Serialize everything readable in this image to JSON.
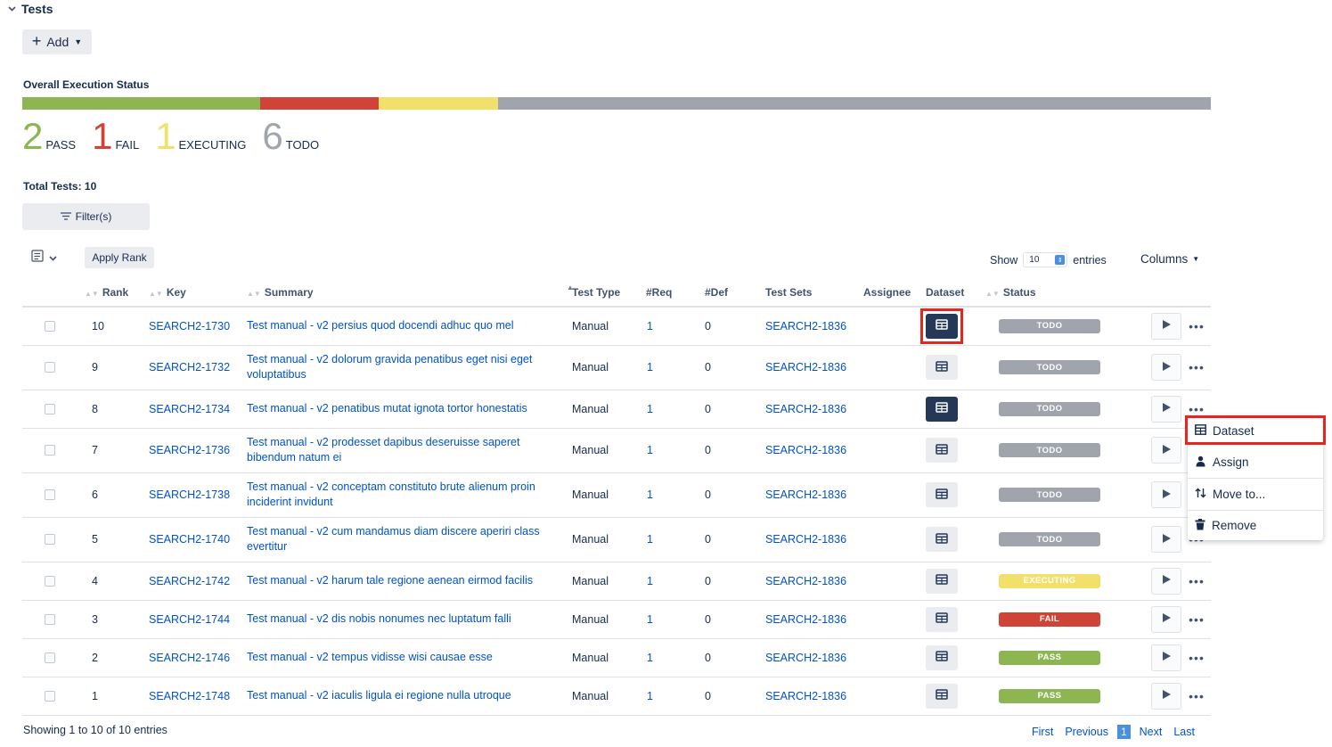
{
  "section": {
    "title": "Tests"
  },
  "toolbar": {
    "add_label": "Add",
    "filter_label": "Filter(s)",
    "apply_rank_label": "Apply Rank"
  },
  "overall": {
    "title": "Overall Execution Status",
    "counts": [
      {
        "num": "2",
        "label": "PASS",
        "color": "#8db653"
      },
      {
        "num": "1",
        "label": "FAIL",
        "color": "#d04437"
      },
      {
        "num": "1",
        "label": "EXECUTING",
        "color": "#f1e069"
      },
      {
        "num": "6",
        "label": "TODO",
        "color": "#a0a5ad"
      }
    ],
    "bar_fractions": [
      0.2,
      0.1,
      0.1,
      0.6
    ]
  },
  "total_tests": "Total Tests: 10",
  "show": {
    "prefix": "Show",
    "value": "10",
    "suffix": "entries"
  },
  "columns_label": "Columns",
  "table": {
    "headers": {
      "rank": "Rank",
      "key": "Key",
      "summary": "Summary",
      "test_type": "Test Type",
      "req": "#Req",
      "def": "#Def",
      "test_sets": "Test Sets",
      "assignee": "Assignee",
      "dataset": "Dataset",
      "status": "Status"
    },
    "rows": [
      {
        "rank": "10",
        "key": "SEARCH2-1730",
        "summary": "Test manual - v2 persius quod docendi adhuc quo mel",
        "type": "Manual",
        "req": "1",
        "def": "0",
        "set": "SEARCH2-1836",
        "status": "TODO",
        "ds_active": true
      },
      {
        "rank": "9",
        "key": "SEARCH2-1732",
        "summary": "Test manual - v2 dolorum gravida penatibus eget nisi eget voluptatibus",
        "type": "Manual",
        "req": "1",
        "def": "0",
        "set": "SEARCH2-1836",
        "status": "TODO",
        "ds_active": false
      },
      {
        "rank": "8",
        "key": "SEARCH2-1734",
        "summary": "Test manual - v2 penatibus mutat ignota tortor honestatis",
        "type": "Manual",
        "req": "1",
        "def": "0",
        "set": "SEARCH2-1836",
        "status": "TODO",
        "ds_active": true
      },
      {
        "rank": "7",
        "key": "SEARCH2-1736",
        "summary": "Test manual - v2 prodesset dapibus deseruisse saperet bibendum natum ei",
        "type": "Manual",
        "req": "1",
        "def": "0",
        "set": "SEARCH2-1836",
        "status": "TODO",
        "ds_active": false
      },
      {
        "rank": "6",
        "key": "SEARCH2-1738",
        "summary": "Test manual - v2 conceptam constituto brute alienum proin inciderint invidunt",
        "type": "Manual",
        "req": "1",
        "def": "0",
        "set": "SEARCH2-1836",
        "status": "TODO",
        "ds_active": false
      },
      {
        "rank": "5",
        "key": "SEARCH2-1740",
        "summary": "Test manual - v2 cum mandamus diam discere aperiri class evertitur",
        "type": "Manual",
        "req": "1",
        "def": "0",
        "set": "SEARCH2-1836",
        "status": "TODO",
        "ds_active": false
      },
      {
        "rank": "4",
        "key": "SEARCH2-1742",
        "summary": "Test manual - v2 harum tale regione aenean eirmod facilis",
        "type": "Manual",
        "req": "1",
        "def": "0",
        "set": "SEARCH2-1836",
        "status": "EXECUTING",
        "ds_active": false
      },
      {
        "rank": "3",
        "key": "SEARCH2-1744",
        "summary": "Test manual - v2 dis nobis nonumes nec luptatum falli",
        "type": "Manual",
        "req": "1",
        "def": "0",
        "set": "SEARCH2-1836",
        "status": "FAIL",
        "ds_active": false
      },
      {
        "rank": "2",
        "key": "SEARCH2-1746",
        "summary": "Test manual - v2 tempus vidisse wisi causae esse",
        "type": "Manual",
        "req": "1",
        "def": "0",
        "set": "SEARCH2-1836",
        "status": "PASS",
        "ds_active": false
      },
      {
        "rank": "1",
        "key": "SEARCH2-1748",
        "summary": "Test manual - v2 iaculis ligula ei regione nulla utroque",
        "type": "Manual",
        "req": "1",
        "def": "0",
        "set": "SEARCH2-1836",
        "status": "PASS",
        "ds_active": false
      }
    ]
  },
  "status_colors": {
    "TODO": "#a0a5ad",
    "EXECUTING": "#f1e069",
    "FAIL": "#d04437",
    "PASS": "#8db653"
  },
  "footer": {
    "showing": "Showing 1 to 10 of 10 entries",
    "first": "First",
    "previous": "Previous",
    "current": "1",
    "next": "Next",
    "last": "Last"
  },
  "context_menu": {
    "items": [
      {
        "label": "Dataset",
        "icon": "table-icon"
      },
      {
        "label": "Assign",
        "icon": "person-icon"
      },
      {
        "label": "Move to...",
        "icon": "sort-arrows-icon"
      },
      {
        "label": "Remove",
        "icon": "trash-icon"
      }
    ]
  }
}
